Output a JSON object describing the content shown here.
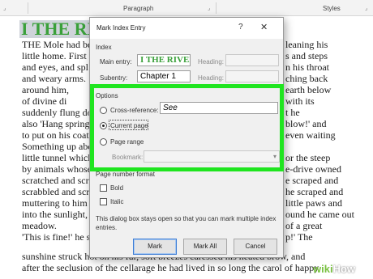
{
  "ribbon": {
    "paragraph_label": "Paragraph",
    "styles_label": "Styles"
  },
  "document": {
    "heading": "I THE RIVER BANK",
    "left_lines": [
      "THE Mole had been",
      "little home. First",
      "and eyes, and spl",
      "and weary arms.",
      "around him,",
      "of divine di",
      "suddenly flung do",
      "also 'Hang spring",
      "to put on his coat",
      "Something up abo",
      "little tunnel which",
      "by animals whose",
      "scratched and scr",
      "scrabbled and scr",
      "muttering to him",
      "into the sunlight,",
      "meadow.",
      "'This is fine!' he s"
    ],
    "right_lines": [
      "leaning his",
      "s and steps",
      "n his throat",
      "ching back",
      "earth below",
      "with its",
      "t he",
      "blow!' and",
      "even waiting",
      "",
      "or the steep",
      "e-drive owned",
      "e scraped and",
      "he scraped and",
      "little paws and",
      "ound he came out",
      "of a great",
      "p!' The"
    ],
    "bottom_lines": [
      "sunshine struck hot on his fur, soft breezes caressed his heated brow, and",
      "after the seclusion of the cellarage he had lived in so long the carol of happy"
    ]
  },
  "dialog": {
    "title": "Mark Index Entry",
    "help_glyph": "?",
    "close_glyph": "✕",
    "index_section": "Index",
    "main_entry_label": "Main entry:",
    "main_entry_value": "I THE RIVER BANK",
    "subentry_label": "Subentry:",
    "subentry_value": "Chapter 1",
    "heading_label": "Heading:",
    "options_label": "Options",
    "cross_reference_label": "Cross-reference:",
    "cross_reference_value": "See",
    "current_page_label": "Current page",
    "page_range_label": "Page range",
    "bookmark_label": "Bookmark:",
    "page_number_format_label": "Page number format",
    "bold_label": "Bold",
    "italic_label": "Italic",
    "note_line1": "This dialog box stays open so that you can mark multiple index",
    "note_line2": "entries.",
    "mark_button": "Mark",
    "mark_all_button": "Mark All",
    "cancel_button": "Cancel"
  },
  "watermark": {
    "wiki": "wiki",
    "how": "How"
  },
  "colors": {
    "highlight": "#1fe51f",
    "heading_text": "#3aa03a",
    "heading_bg": "#cfd4da"
  }
}
